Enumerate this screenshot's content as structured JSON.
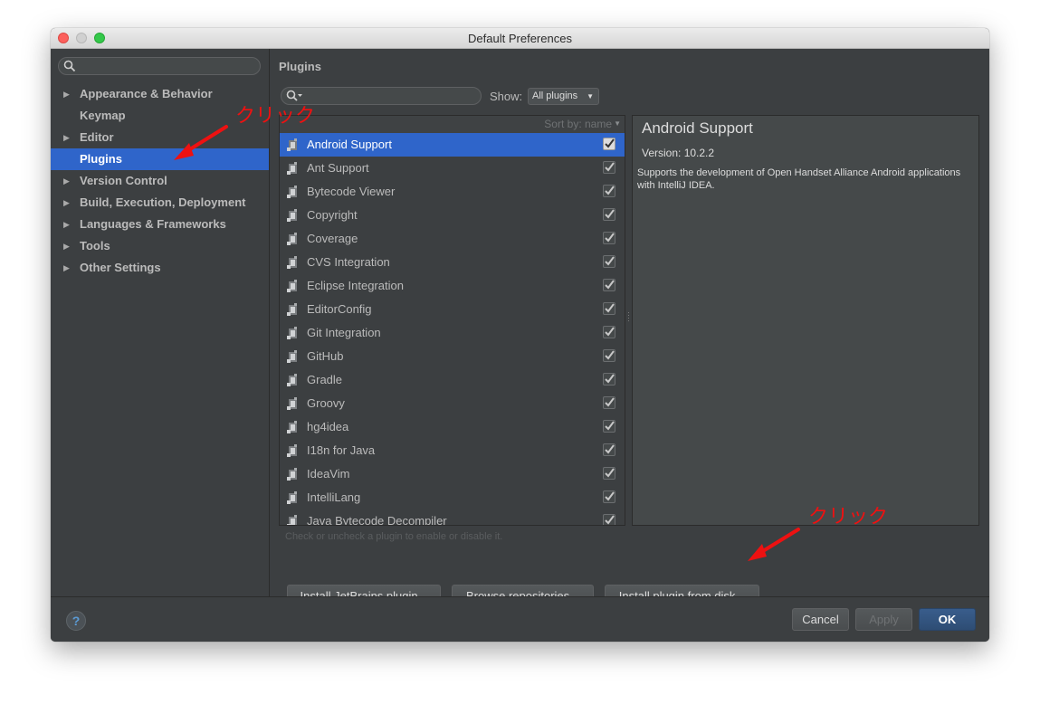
{
  "window": {
    "title": "Default Preferences"
  },
  "sidebar": {
    "items": [
      {
        "label": "Appearance & Behavior",
        "expandable": true,
        "selected": false
      },
      {
        "label": "Keymap",
        "expandable": false,
        "selected": false
      },
      {
        "label": "Editor",
        "expandable": true,
        "selected": false
      },
      {
        "label": "Plugins",
        "expandable": false,
        "selected": true
      },
      {
        "label": "Version Control",
        "expandable": true,
        "selected": false
      },
      {
        "label": "Build, Execution, Deployment",
        "expandable": true,
        "selected": false
      },
      {
        "label": "Languages & Frameworks",
        "expandable": true,
        "selected": false
      },
      {
        "label": "Tools",
        "expandable": true,
        "selected": false
      },
      {
        "label": "Other Settings",
        "expandable": true,
        "selected": false
      }
    ]
  },
  "plugins_panel": {
    "title": "Plugins",
    "show_label": "Show:",
    "show_value": "All plugins",
    "sort_label": "Sort by: name",
    "hint": "Check or uncheck a plugin to enable or disable it.",
    "plugins": [
      {
        "name": "Android Support",
        "enabled": true,
        "selected": true
      },
      {
        "name": "Ant Support",
        "enabled": true
      },
      {
        "name": "Bytecode Viewer",
        "enabled": true
      },
      {
        "name": "Copyright",
        "enabled": true
      },
      {
        "name": "Coverage",
        "enabled": true
      },
      {
        "name": "CVS Integration",
        "enabled": true
      },
      {
        "name": "Eclipse Integration",
        "enabled": true
      },
      {
        "name": "EditorConfig",
        "enabled": true
      },
      {
        "name": "Git Integration",
        "enabled": true
      },
      {
        "name": "GitHub",
        "enabled": true
      },
      {
        "name": "Gradle",
        "enabled": true
      },
      {
        "name": "Groovy",
        "enabled": true
      },
      {
        "name": "hg4idea",
        "enabled": true
      },
      {
        "name": "I18n for Java",
        "enabled": true
      },
      {
        "name": "IdeaVim",
        "enabled": true
      },
      {
        "name": "IntelliLang",
        "enabled": true
      },
      {
        "name": "Java Bytecode Decompiler",
        "enabled": true
      }
    ],
    "buttons": {
      "install_jetbrains": "Install JetBrains plugin...",
      "browse": "Browse repositories...",
      "install_disk": "Install plugin from disk..."
    }
  },
  "details": {
    "title": "Android Support",
    "version": "Version: 10.2.2",
    "description": "Supports the development of Open Handset Alliance Android applications with IntelliJ IDEA."
  },
  "footer": {
    "help": "?",
    "cancel": "Cancel",
    "apply": "Apply",
    "ok": "OK"
  },
  "annotations": {
    "click_1": "クリック",
    "click_2": "クリック"
  },
  "colors": {
    "selection": "#2f65ca",
    "annotation": "#ee1111",
    "ok_button": "#2e4d74"
  }
}
